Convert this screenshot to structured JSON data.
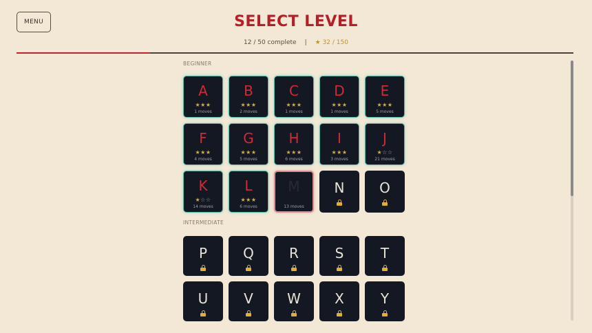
{
  "menu_label": "MENU",
  "title": "SELECT LEVEL",
  "progress_text": "12 / 50 complete",
  "separator": "|",
  "stars_text": "★ 32 / 150",
  "progress_fraction": 0.24,
  "sections": [
    {
      "label": "BEGINNER",
      "levels": [
        {
          "letter": "A",
          "state": "completed",
          "stars": 3,
          "moves": "1 moves"
        },
        {
          "letter": "B",
          "state": "completed",
          "stars": 3,
          "moves": "2 moves"
        },
        {
          "letter": "C",
          "state": "completed",
          "stars": 3,
          "moves": "1 moves"
        },
        {
          "letter": "D",
          "state": "completed",
          "stars": 3,
          "moves": "1 moves"
        },
        {
          "letter": "E",
          "state": "completed",
          "stars": 3,
          "moves": "5 moves"
        },
        {
          "letter": "F",
          "state": "completed",
          "stars": 3,
          "moves": "4 moves"
        },
        {
          "letter": "G",
          "state": "completed",
          "stars": 3,
          "moves": "5 moves"
        },
        {
          "letter": "H",
          "state": "completed",
          "stars": 3,
          "moves": "6 moves"
        },
        {
          "letter": "I",
          "state": "completed",
          "stars": 3,
          "moves": "3 moves"
        },
        {
          "letter": "J",
          "state": "completed",
          "stars": 1,
          "moves": "21 moves"
        },
        {
          "letter": "K",
          "state": "completed",
          "stars": 1,
          "moves": "14 moves"
        },
        {
          "letter": "L",
          "state": "completed",
          "stars": 3,
          "moves": "6 moves"
        },
        {
          "letter": "M",
          "state": "current",
          "stars": 0,
          "moves": "13 moves"
        },
        {
          "letter": "N",
          "state": "locked"
        },
        {
          "letter": "O",
          "state": "locked"
        }
      ]
    },
    {
      "label": "INTERMEDIATE",
      "levels": [
        {
          "letter": "P",
          "state": "locked"
        },
        {
          "letter": "Q",
          "state": "locked"
        },
        {
          "letter": "R",
          "state": "locked"
        },
        {
          "letter": "S",
          "state": "locked"
        },
        {
          "letter": "T",
          "state": "locked"
        },
        {
          "letter": "U",
          "state": "locked"
        },
        {
          "letter": "V",
          "state": "locked"
        },
        {
          "letter": "W",
          "state": "locked"
        },
        {
          "letter": "X",
          "state": "locked"
        },
        {
          "letter": "Y",
          "state": "locked"
        }
      ]
    }
  ],
  "colors": {
    "background": "#f3e8d6",
    "accent": "#b3202a",
    "tile": "#141822",
    "completed_glow": "#57b8a6",
    "star": "#d4b048",
    "lock": "#e0b030"
  },
  "icons": {
    "lock": "lock-icon",
    "star": "star-icon"
  }
}
